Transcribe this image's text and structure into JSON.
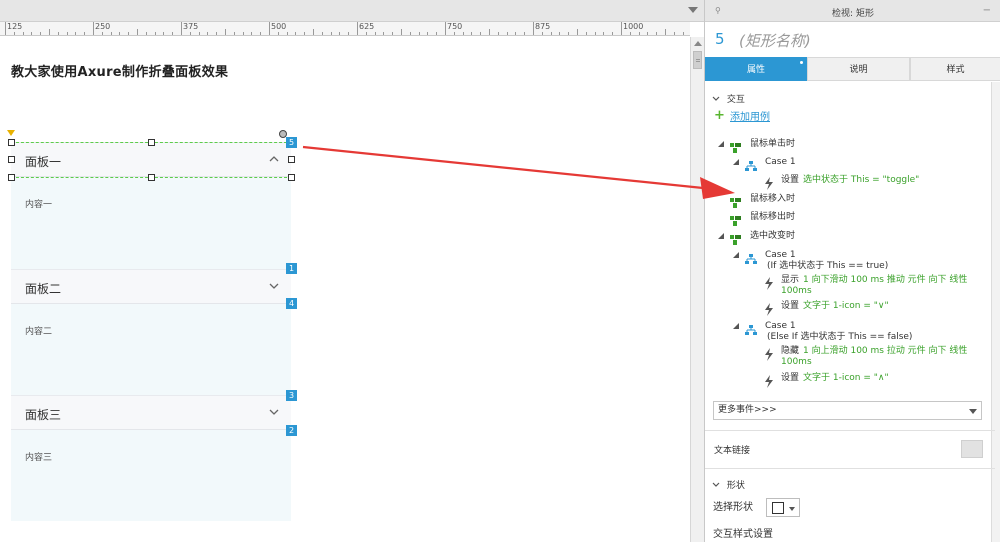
{
  "ruler": {
    "labels": [
      "125",
      "250",
      "375",
      "500",
      "625",
      "750",
      "875",
      "1000"
    ]
  },
  "canvas": {
    "title": "教大家使用Axure制作折叠面板效果",
    "panels": [
      {
        "title": "面板一",
        "content": "内容一"
      },
      {
        "title": "面板二",
        "content": "内容二"
      },
      {
        "title": "面板三",
        "content": "内容三"
      }
    ],
    "badges": [
      "5",
      "1",
      "4",
      "3",
      "2"
    ]
  },
  "inspector": {
    "header": "检视: 矩形",
    "id": "5",
    "name": "(矩形名称)",
    "tabs": [
      "属性",
      "说明",
      "样式"
    ],
    "interaction_label": "交互",
    "add_case": "添加用例",
    "events": {
      "click": "鼠标单击时",
      "click_case": "Case 1",
      "click_action": "设置",
      "click_action_detail": "选中状态于 This = \"toggle\"",
      "mouse_enter": "鼠标移入时",
      "mouse_leave": "鼠标移出时",
      "selected_change": "选中改变时",
      "case1": "Case 1",
      "case1_cond": "(If 选中状态于 This == true)",
      "case1_a1_verb": "显示",
      "case1_a1_detail": "1 向下滑动 100 ms 推动 元件 向下 线性",
      "case1_a1_time": "100ms",
      "case1_a2_verb": "设置",
      "case1_a2_detail": "文字于 1-icon = \"∨\"",
      "case2": "Case 1",
      "case2_cond": "(Else If 选中状态于 This == false)",
      "case2_a1_verb": "隐藏",
      "case2_a1_detail": "1 向上滑动 100 ms 拉动 元件 向下 线性",
      "case2_a1_time": "100ms",
      "case2_a2_verb": "设置",
      "case2_a2_detail": "文字于 1-icon = \"∧\""
    },
    "more_events": "更多事件>>>",
    "text_link": "文本链接",
    "shape_section": "形状",
    "select_shape": "选择形状",
    "interaction_style": "交互样式设置"
  },
  "colors": {
    "accent": "#2c97d3",
    "green_text": "#3aa12a",
    "arrow": "#e53935"
  }
}
